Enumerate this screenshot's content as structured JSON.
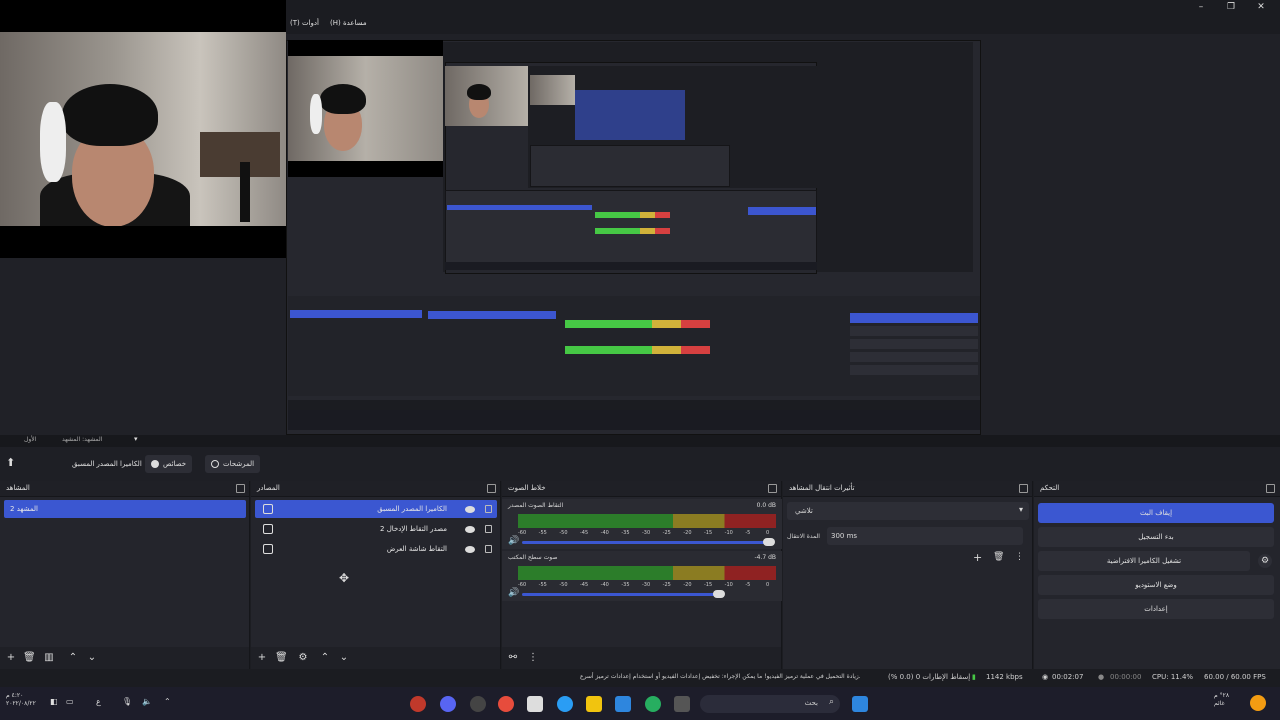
{
  "window": {
    "menu": [
      "(H) مساعدة",
      "(T) أدوات"
    ],
    "controls": [
      "minimize-icon",
      "maximize-icon",
      "close-icon"
    ]
  },
  "scene_bar": {
    "label": "المشهد: المشهد",
    "tab": "الأول"
  },
  "toolbar": {
    "source_name": "الكاميرا المصدر المسبق",
    "properties_label": "خصائص",
    "filters_label": "المرشحات"
  },
  "docks": {
    "scenes": {
      "title": "المشاهد",
      "items": [
        "المشهد 2"
      ]
    },
    "sources": {
      "title": "المصادر",
      "items": [
        {
          "label": "الكاميرا المصدر المسبق",
          "icon": "camera-icon"
        },
        {
          "label": "مصدر التقاط الإدخال 2",
          "icon": "camera-icon"
        },
        {
          "label": "التقاط شاشة العرض",
          "icon": "monitor-icon"
        }
      ]
    },
    "mixer": {
      "title": "خلاط الصوت",
      "channels": [
        {
          "name": "التقاط الصوت المصدر",
          "db": "0.0 dB",
          "level": 0.98
        },
        {
          "name": "صوت سطح المكتب",
          "db": "-4.7 dB",
          "level": 0.78
        }
      ],
      "ticks": [
        "-60",
        "-55",
        "-50",
        "-45",
        "-40",
        "-35",
        "-30",
        "-25",
        "-20",
        "-15",
        "-10",
        "-5",
        "0"
      ]
    },
    "transitions": {
      "title": "تأثيرات انتقال المشاهد",
      "selected": "تلاشي",
      "duration_label": "المدة الانتقال",
      "duration_value": "300 ms"
    },
    "controls": {
      "title": "التحكم",
      "buttons": [
        "إيقاف البث",
        "بدء التسجيل",
        "تشغيل الكاميرا الافتراضية",
        "وضع الاستوديو",
        "إعدادات"
      ]
    }
  },
  "status": {
    "message": "زيادة التحميل في عملية ترميز الفيديو! ما يمكن الإجراء: تخفيض إعدادات الفيديو أو استخدام إعدادات ترميز أسرع.",
    "dropped": "إسقاط الإطارات 0 (0.0 %)",
    "bitrate": "1142 kbps",
    "stream_time": "00:02:07",
    "rec_time": "00:00:00",
    "cpu": "CPU: 11.4%",
    "fps": "60.00 / 60.00 FPS"
  },
  "taskbar": {
    "search": "بحث",
    "clock_time": "٤:٢٠ م",
    "clock_date": "٢٠٢٢/٠٨/٢٢",
    "lang": "ع",
    "weather": "‏٢٨° م",
    "weather_sub": "غائم"
  },
  "colors": {
    "accent": "#3b57d1",
    "background": "#1e1f25"
  }
}
